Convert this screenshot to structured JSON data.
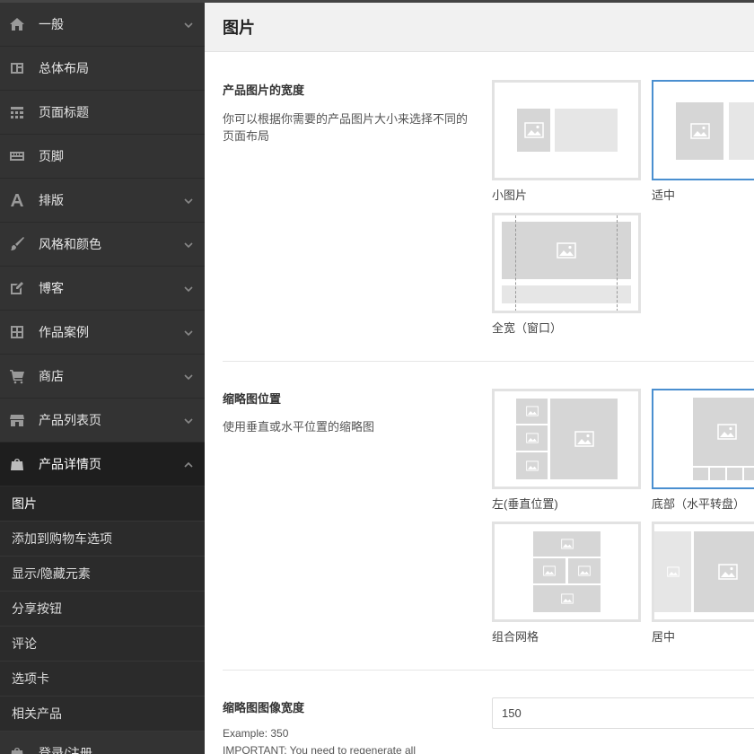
{
  "sidebar": {
    "items": [
      {
        "label": "一般",
        "icon": "home-icon",
        "chevron": true
      },
      {
        "label": "总体布局",
        "icon": "layout-icon",
        "chevron": false
      },
      {
        "label": "页面标题",
        "icon": "header-grid-icon",
        "chevron": false
      },
      {
        "label": "页脚",
        "icon": "footer-keyboard-icon",
        "chevron": false
      },
      {
        "label": "排版",
        "icon": "typography-icon",
        "chevron": true
      },
      {
        "label": "风格和颜色",
        "icon": "brush-icon",
        "chevron": true
      },
      {
        "label": "博客",
        "icon": "edit-icon",
        "chevron": true
      },
      {
        "label": "作品案例",
        "icon": "grid-icon",
        "chevron": true
      },
      {
        "label": "商店",
        "icon": "cart-icon",
        "chevron": true
      },
      {
        "label": "产品列表页",
        "icon": "store-icon",
        "chevron": true
      },
      {
        "label": "产品详情页",
        "icon": "bag-icon",
        "chevron": true,
        "expanded": true
      }
    ],
    "sub_items": [
      "图片",
      "添加到购物车选项",
      "显示/隐藏元素",
      "分享按钮",
      "评论",
      "选项卡",
      "相关产品"
    ],
    "bottom_item": {
      "label": "登录/注册",
      "icon": "login-icon"
    }
  },
  "page": {
    "title": "图片"
  },
  "section_width": {
    "title": "产品图片的宽度",
    "desc": "你可以根据你需要的产品图片大小来选择不同的页面布局",
    "options": [
      "小图片",
      "适中",
      "全宽（窗口）"
    ],
    "selected": "适中"
  },
  "section_thumb": {
    "title": "缩略图位置",
    "desc": "使用垂直或水平位置的缩略图",
    "options": [
      "左(垂直位置)",
      "底部（水平转盘）",
      "组合网格",
      "居中"
    ],
    "selected": "底部（水平转盘）"
  },
  "section_thumb_width": {
    "title": "缩略图图像宽度",
    "value": "150",
    "example": "Example: 350",
    "important": "IMPORTANT: You need to regenerate all"
  },
  "colors": {
    "sidebar": "#333333",
    "accent": "#4a8fd0",
    "placeholder": "#d6d6d6"
  }
}
